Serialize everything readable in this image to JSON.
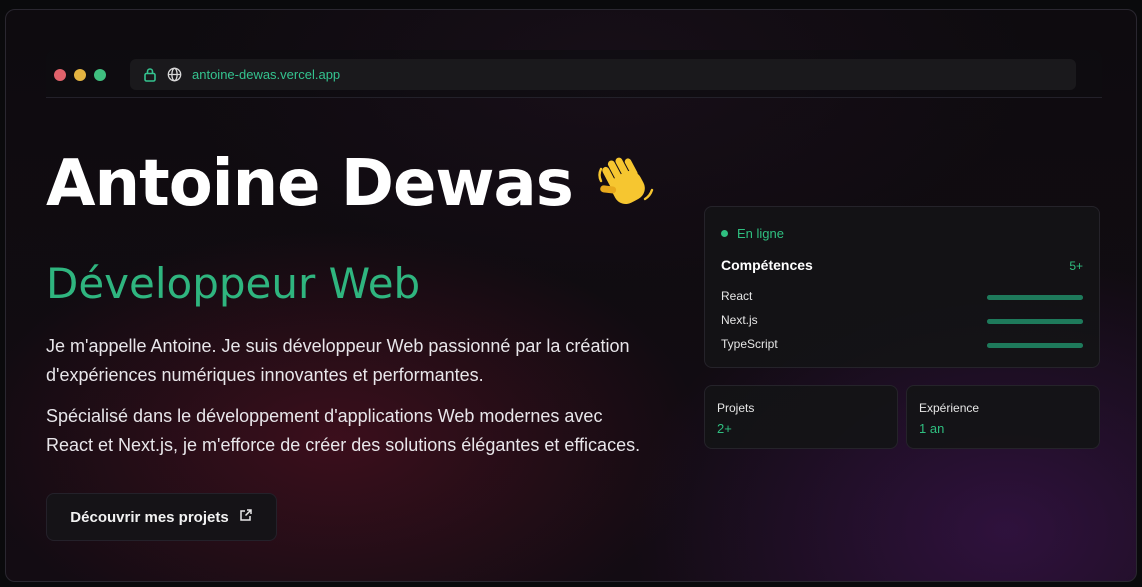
{
  "browser": {
    "url": "antoine-dewas.vercel.app",
    "icons": [
      "lock-icon",
      "globe-icon"
    ]
  },
  "hero": {
    "name": "Antoine Dewas",
    "emoji_icon": "waving-hand-icon",
    "role": "Développeur Web",
    "paragraph1": "Je m'appelle Antoine. Je suis développeur Web passionné par la création d'expériences numériques innovantes et performantes.",
    "paragraph2": "Spécialisé dans le développement d'applications Web modernes avec React et Next.js, je m'efforce de créer des solutions élégantes et efficaces.",
    "cta_label": "Découvrir mes projets",
    "cta_icon": "external-link-icon"
  },
  "status_card": {
    "status": "En ligne",
    "skills_title": "Compétences",
    "skills_count": "5+",
    "skills": [
      {
        "name": "React",
        "level": 1.0
      },
      {
        "name": "Next.js",
        "level": 1.0
      },
      {
        "name": "TypeScript",
        "level": 1.0
      }
    ]
  },
  "stats": {
    "projects_label": "Projets",
    "projects_value": "2+",
    "experience_label": "Expérience",
    "experience_value": "1 an"
  },
  "colors": {
    "accent": "#2fb57f",
    "background": "#0e0b0f"
  }
}
